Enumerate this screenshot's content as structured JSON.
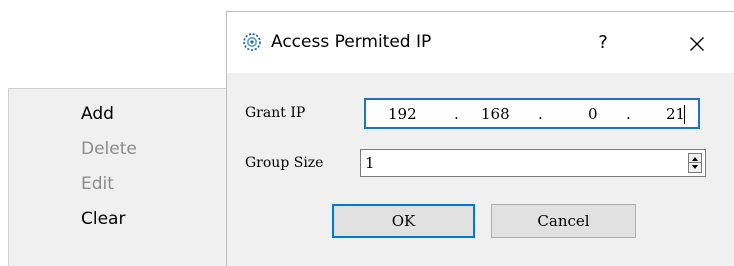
{
  "context_menu": {
    "items": [
      {
        "label": "Add",
        "enabled": true
      },
      {
        "label": "Delete",
        "enabled": false
      },
      {
        "label": "Edit",
        "enabled": false
      },
      {
        "label": "Clear",
        "enabled": true
      }
    ]
  },
  "dialog": {
    "title": "Access Permited IP",
    "help_label": "?",
    "close_icon": "close-icon",
    "app_icon": "gear-icon",
    "grant_ip": {
      "label": "Grant IP",
      "octets": [
        "192",
        "168",
        "0",
        "21"
      ],
      "separator": "."
    },
    "group_size": {
      "label": "Group Size",
      "value": "1"
    },
    "buttons": {
      "ok": "OK",
      "cancel": "Cancel"
    }
  },
  "colors": {
    "focus_border": "#1f6fc5",
    "default_button_border": "#0078d7",
    "dialog_bg": "#f0f0f0",
    "disabled_text": "#8c8c8c"
  }
}
